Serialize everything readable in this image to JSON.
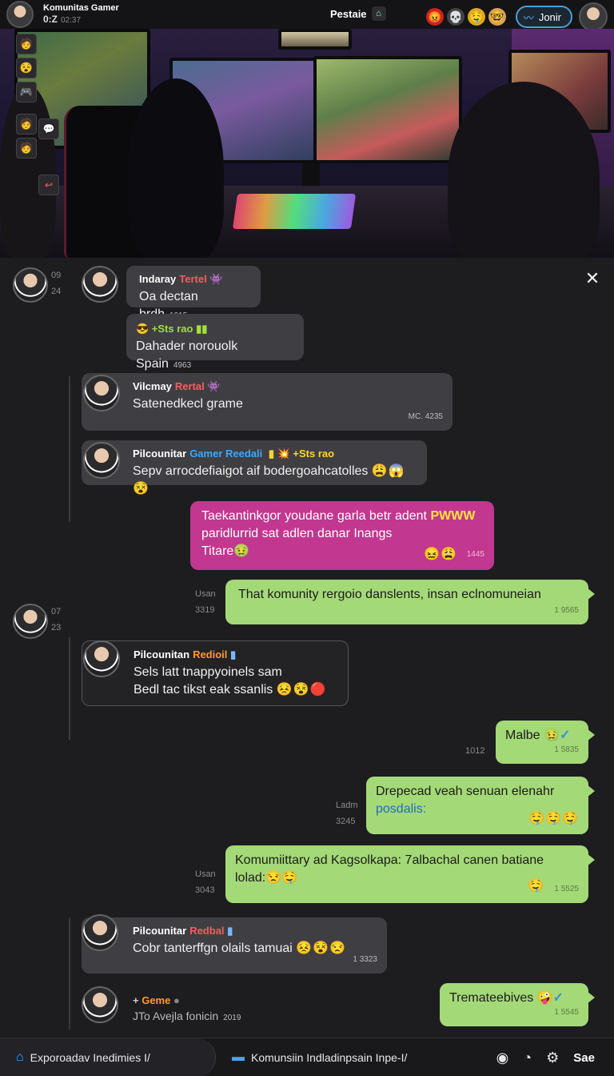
{
  "topbar": {
    "title": "Komunitas Gamer",
    "subtitle": "0:Z",
    "subtitle_small": "02:37",
    "center_label": "Pestaie",
    "join_label": "Jonir",
    "reactions": [
      "😡",
      "💀",
      "🤤",
      "🤓"
    ]
  },
  "hero": {
    "side_icons": [
      "🧑",
      "😵",
      "🎮",
      "🧑",
      "🧑"
    ],
    "side_icons2": [
      "💬",
      "↩",
      "⚪"
    ]
  },
  "chat": {
    "close_label": "✕",
    "gutter": [
      {
        "line1": "09",
        "line2": "24"
      },
      {
        "line1": "07",
        "line2": "23"
      }
    ],
    "messages": [
      {
        "name": "Indaray",
        "role": "Tertel",
        "badge": "👾",
        "text": "Oa dectan brdh",
        "ts": "1015"
      },
      {
        "prefix": "😎 +Sts rao ▮▮",
        "text": "Dahader norouolk Spain",
        "ts": "4963"
      },
      {
        "name": "Vilcmay",
        "role": "Rertal",
        "badge": "👾",
        "text": "Satenedkecl grame",
        "ts": "MC. 4235"
      },
      {
        "name": "Pilcounitar",
        "role": "Gamer Reedali",
        "badge": "▮ 💥 +Sts rao",
        "text": "Sepv arrocdefiaigot aif bodergoahcatolles",
        "emojis": "😩😱😵"
      },
      {
        "text1": "Taekantinkgor youdane garla betr adent",
        "highlight": "PWWW",
        "text2": "paridlurrid sat adlen danar Inangs",
        "text3": "Titare",
        "emojis": "😖😩",
        "ts": "1445"
      },
      {
        "meta1": "Usan",
        "meta2": "3319",
        "text": "That komunity rergoio danslents, insan eclnomuneian",
        "ts": "1 9565"
      },
      {
        "name": "Pilcounitan",
        "role": "Redioil",
        "badge": "▮",
        "text1": "Sels latt tnappyoinels sam",
        "text2": "Bedl tac tikst eak ssanlis",
        "emojis": "😣😵🔴"
      },
      {
        "meta": "1012",
        "text": "Malbe",
        "emojis": "🤢",
        "ts": "1 5835"
      },
      {
        "meta1": "Ladm",
        "meta2": "3245",
        "text1": "Drepecad veah senuan elenahr",
        "text2": "posdalis:",
        "emojis": "🤤🤤🤤"
      },
      {
        "meta1": "Usan",
        "meta2": "3043",
        "text1": "Komumiittary ad Kagsolkapa: 7albachal canen batiane",
        "text2": "lolad:",
        "emojis_inline": "😒🤤",
        "emojis": "🤤",
        "ts": "1 5525"
      },
      {
        "name": "Pilcounitar",
        "role": "Redbal",
        "badge": "▮",
        "text": "Cobr tanterffgn olails tamuai",
        "emojis": "😣😵😒",
        "ts": "1 3323"
      },
      {
        "name": "Geme",
        "prefix": "+",
        "badge": "●",
        "text": "JTo Avejla fonicin",
        "ts": "2019"
      },
      {
        "text": "Tremateebives",
        "emojis": "🤪",
        "ts": "1 5545"
      }
    ]
  },
  "bottombar": {
    "tab1": "Exporoadav Inedimies I/",
    "tab2": "Komunsiin Indladinpsain Inpe-I/",
    "save_label": "Sae"
  }
}
